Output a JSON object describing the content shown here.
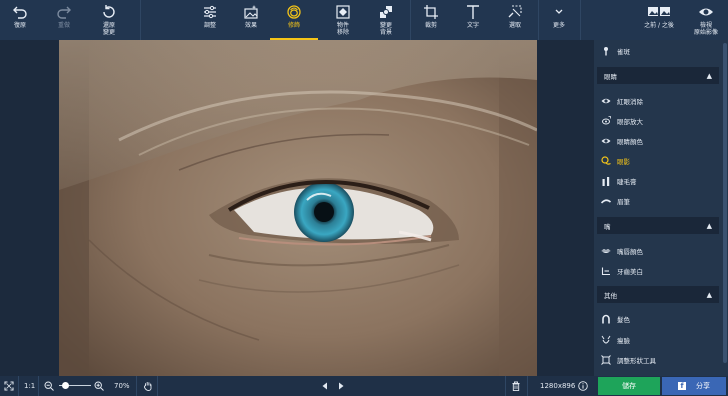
{
  "toolbar": {
    "undo": "復原",
    "redo": "重做",
    "restore": "還原\n變更",
    "adjust": "調整",
    "effects": "效果",
    "retouch": "修飾",
    "object_removal": "物件\n移除",
    "change_background": "變更\n背景",
    "crop": "裁剪",
    "text": "文字",
    "selection": "選取",
    "more": "更多",
    "before_after": "之前 / 之後",
    "view_original": "檢視\n原始影像"
  },
  "panel": {
    "top_item": "雀斑",
    "sections": [
      {
        "title": "眼睛",
        "items": [
          "紅眼消除",
          "眼部放大",
          "眼睛顏色",
          "眼影",
          "睫毛膏",
          "眉筆"
        ]
      },
      {
        "title": "嘴",
        "items": [
          "嘴唇顏色",
          "牙齒美白"
        ]
      },
      {
        "title": "其他",
        "items": [
          "髮色",
          "瘦臉",
          "調整形狀工具"
        ]
      }
    ],
    "active_item": "眼影"
  },
  "bottom": {
    "actual_size": "1:1",
    "zoom": "70%",
    "zoom_level": 0.2,
    "dimensions": "1280x896",
    "save": "儲存",
    "share": "分享"
  },
  "colors": {
    "accent": "#f5c518",
    "save": "#1ea45a",
    "share": "#3a67b5"
  }
}
